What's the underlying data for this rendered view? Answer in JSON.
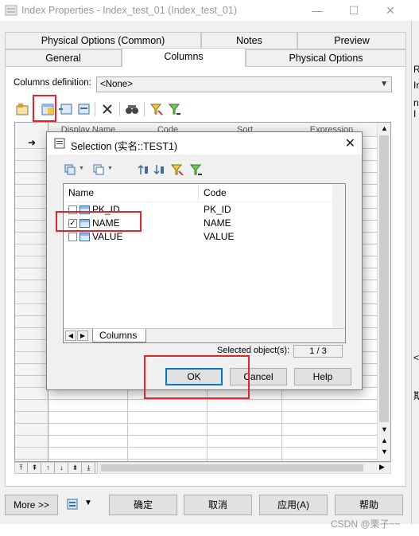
{
  "window": {
    "title": "Index Properties - Index_test_01 (Index_test_01)",
    "minimize": "—",
    "maximize": "☐",
    "close": "✕"
  },
  "tabs_row1": [
    "Physical Options (Common)",
    "Notes",
    "Preview"
  ],
  "tabs_row2": [
    "General",
    "Columns",
    "Physical Options"
  ],
  "active_tab": "Columns",
  "columns_definition": {
    "label": "Columns definition:",
    "value": "<None>"
  },
  "grid": {
    "headers": [
      "Display Name",
      "Code",
      "Sort",
      "Expression"
    ],
    "current_row_marker": "➜"
  },
  "right_strip": [
    "Ru",
    "In",
    "n I",
    "<",
    "期"
  ],
  "bottom_buttons": {
    "more": "More >>",
    "ok": "确定",
    "cancel": "取消",
    "apply": "应用(A)",
    "help": "帮助"
  },
  "dialog": {
    "title": "Selection (实名::TEST1)",
    "columns": [
      "Name",
      "Code"
    ],
    "rows": [
      {
        "name": "PK_ID",
        "code": "PK_ID",
        "checked": false
      },
      {
        "name": "NAME",
        "code": "NAME",
        "checked": true
      },
      {
        "name": "VALUE",
        "code": "VALUE",
        "checked": false
      }
    ],
    "sheet_tab": "Columns",
    "selected_label": "Selected object(s):",
    "selected_value": "1 / 3",
    "ok": "OK",
    "cancel": "Cancel",
    "help": "Help"
  },
  "watermark": "CSDN @栗子~~",
  "colors": {
    "highlight_red": "#e8222a",
    "window_bg": "#f0f0f0",
    "ok_focus": "#0078d7"
  }
}
